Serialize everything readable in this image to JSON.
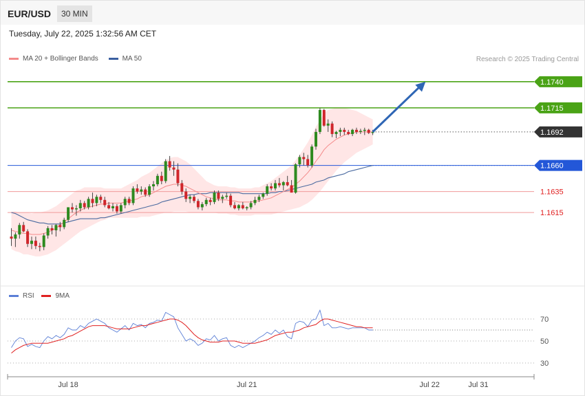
{
  "header": {
    "pair": "EUR/USD",
    "timeframe": "30 MIN"
  },
  "date_line": "Tuesday, July 22, 2025 1:32:56 AM CET",
  "legend": {
    "price": [
      {
        "label": "MA 20 + Bollinger Bands",
        "color": "#f48a8a"
      },
      {
        "label": "MA 50",
        "color": "#3a5fa0"
      }
    ],
    "rsi": [
      {
        "label": "RSI",
        "color": "#5b7fd6"
      },
      {
        "label": "9MA",
        "color": "#e02020"
      }
    ]
  },
  "credit": "Research © 2025 Trading Central",
  "chart_data": [
    {
      "type": "candlestick",
      "pair": "EUR/USD",
      "timeframe": "30 MIN",
      "ylim": [
        1.155,
        1.1755
      ],
      "levels": [
        {
          "value": 1.174,
          "label": "1.1740",
          "kind": "target",
          "color": "#4aa316"
        },
        {
          "value": 1.1715,
          "label": "1.1715",
          "kind": "resistance",
          "color": "#4aa316"
        },
        {
          "value": 1.1692,
          "label": "1.1692",
          "kind": "last",
          "color": "#333333"
        },
        {
          "value": 1.166,
          "label": "1.1660",
          "kind": "pivot",
          "color": "#2357d8"
        },
        {
          "value": 1.1635,
          "label": "1.1635",
          "kind": "support",
          "color": "#e04040"
        },
        {
          "value": 1.1615,
          "label": "1.1615",
          "kind": "support",
          "color": "#e04040"
        }
      ],
      "x_ticks": [
        {
          "label": "Jul 18",
          "index": 14
        },
        {
          "label": "Jul 21",
          "index": 58
        },
        {
          "label": "Jul 22",
          "index": 103
        },
        {
          "label": "Jul 31",
          "index": 115
        }
      ],
      "ohlc": [
        [
          1.1592,
          1.16,
          1.1583,
          1.159
        ],
        [
          1.159,
          1.1596,
          1.1582,
          1.1594
        ],
        [
          1.1594,
          1.1605,
          1.159,
          1.1603
        ],
        [
          1.1603,
          1.1606,
          1.1596,
          1.1597
        ],
        [
          1.1597,
          1.1599,
          1.1582,
          1.1585
        ],
        [
          1.1585,
          1.1592,
          1.158,
          1.1588
        ],
        [
          1.1588,
          1.1592,
          1.158,
          1.1583
        ],
        [
          1.1583,
          1.1586,
          1.1578,
          1.1582
        ],
        [
          1.1582,
          1.1595,
          1.1579,
          1.1593
        ],
        [
          1.1593,
          1.1602,
          1.159,
          1.16
        ],
        [
          1.16,
          1.1603,
          1.1594,
          1.1598
        ],
        [
          1.1598,
          1.1604,
          1.1592,
          1.1603
        ],
        [
          1.1603,
          1.1606,
          1.1597,
          1.1601
        ],
        [
          1.1601,
          1.161,
          1.1599,
          1.1608
        ],
        [
          1.1608,
          1.162,
          1.1606,
          1.162
        ],
        [
          1.162,
          1.1624,
          1.1615,
          1.1618
        ],
        [
          1.1618,
          1.1622,
          1.1612,
          1.1619
        ],
        [
          1.1619,
          1.1627,
          1.1616,
          1.1624
        ],
        [
          1.1624,
          1.1626,
          1.1618,
          1.162
        ],
        [
          1.162,
          1.163,
          1.1618,
          1.1628
        ],
        [
          1.1628,
          1.1634,
          1.162,
          1.1624
        ],
        [
          1.1624,
          1.1632,
          1.1621,
          1.163
        ],
        [
          1.163,
          1.1632,
          1.1624,
          1.1627
        ],
        [
          1.1627,
          1.163,
          1.162,
          1.1622
        ],
        [
          1.1622,
          1.1625,
          1.1618,
          1.1619
        ],
        [
          1.1619,
          1.1624,
          1.1616,
          1.1621
        ],
        [
          1.1621,
          1.1623,
          1.1614,
          1.1616
        ],
        [
          1.1616,
          1.1624,
          1.1614,
          1.1622
        ],
        [
          1.1622,
          1.163,
          1.1619,
          1.1628
        ],
        [
          1.1628,
          1.163,
          1.1622,
          1.1624
        ],
        [
          1.1624,
          1.164,
          1.1622,
          1.1638
        ],
        [
          1.1638,
          1.1642,
          1.1633,
          1.1635
        ],
        [
          1.1635,
          1.164,
          1.1632,
          1.1637
        ],
        [
          1.1637,
          1.1639,
          1.163,
          1.1632
        ],
        [
          1.1632,
          1.1642,
          1.163,
          1.164
        ],
        [
          1.164,
          1.1645,
          1.1636,
          1.1642
        ],
        [
          1.1642,
          1.1652,
          1.164,
          1.165
        ],
        [
          1.165,
          1.1654,
          1.1642,
          1.1645
        ],
        [
          1.1645,
          1.1666,
          1.1643,
          1.1664
        ],
        [
          1.1664,
          1.1669,
          1.1655,
          1.1658
        ],
        [
          1.1658,
          1.1664,
          1.165,
          1.1656
        ],
        [
          1.1656,
          1.1662,
          1.164,
          1.1643
        ],
        [
          1.1643,
          1.1646,
          1.1632,
          1.1635
        ],
        [
          1.1635,
          1.1638,
          1.1625,
          1.1628
        ],
        [
          1.1628,
          1.1632,
          1.1624,
          1.163
        ],
        [
          1.163,
          1.1632,
          1.1624,
          1.1626
        ],
        [
          1.1626,
          1.1628,
          1.1618,
          1.162
        ],
        [
          1.162,
          1.1625,
          1.1617,
          1.1623
        ],
        [
          1.1623,
          1.1629,
          1.1621,
          1.1627
        ],
        [
          1.1627,
          1.1629,
          1.1622,
          1.1625
        ],
        [
          1.1625,
          1.1636,
          1.1623,
          1.1634
        ],
        [
          1.1634,
          1.1636,
          1.1626,
          1.1628
        ],
        [
          1.1628,
          1.1632,
          1.1624,
          1.163
        ],
        [
          1.163,
          1.1634,
          1.1628,
          1.1631
        ],
        [
          1.1631,
          1.1633,
          1.162,
          1.1622
        ],
        [
          1.1622,
          1.1625,
          1.1618,
          1.1619
        ],
        [
          1.1619,
          1.1623,
          1.1617,
          1.1622
        ],
        [
          1.1622,
          1.1625,
          1.1618,
          1.1619
        ],
        [
          1.1619,
          1.1621,
          1.1617,
          1.162
        ],
        [
          1.162,
          1.1626,
          1.1618,
          1.1624
        ],
        [
          1.1624,
          1.163,
          1.1622,
          1.1627
        ],
        [
          1.1627,
          1.1632,
          1.1625,
          1.163
        ],
        [
          1.163,
          1.1634,
          1.1628,
          1.1633
        ],
        [
          1.1633,
          1.1642,
          1.1631,
          1.164
        ],
        [
          1.164,
          1.1643,
          1.1636,
          1.1638
        ],
        [
          1.1638,
          1.1646,
          1.1636,
          1.1643
        ],
        [
          1.1643,
          1.1648,
          1.1639,
          1.1641
        ],
        [
          1.1641,
          1.1645,
          1.1636,
          1.1644
        ],
        [
          1.1644,
          1.165,
          1.164,
          1.1641
        ],
        [
          1.1641,
          1.1646,
          1.1635,
          1.1634
        ],
        [
          1.1634,
          1.1662,
          1.1633,
          1.1661
        ],
        [
          1.1661,
          1.167,
          1.1658,
          1.1668
        ],
        [
          1.1668,
          1.1672,
          1.166,
          1.1666
        ],
        [
          1.1666,
          1.167,
          1.1658,
          1.166
        ],
        [
          1.166,
          1.168,
          1.1658,
          1.1678
        ],
        [
          1.1678,
          1.1695,
          1.1675,
          1.1692
        ],
        [
          1.1692,
          1.1715,
          1.169,
          1.1713
        ],
        [
          1.1713,
          1.1714,
          1.1697,
          1.1698
        ],
        [
          1.1698,
          1.1704,
          1.1692,
          1.17
        ],
        [
          1.17,
          1.1702,
          1.1687,
          1.169
        ],
        [
          1.169,
          1.1693,
          1.1686,
          1.1692
        ],
        [
          1.1692,
          1.1696,
          1.1688,
          1.1694
        ],
        [
          1.1694,
          1.1696,
          1.1689,
          1.1692
        ],
        [
          1.1692,
          1.1694,
          1.1689,
          1.169
        ],
        [
          1.169,
          1.1695,
          1.1688,
          1.1694
        ],
        [
          1.1694,
          1.1696,
          1.169,
          1.1692
        ],
        [
          1.1692,
          1.1695,
          1.169,
          1.1693
        ],
        [
          1.1693,
          1.1696,
          1.1689,
          1.1694
        ],
        [
          1.1694,
          1.1695,
          1.169,
          1.1691
        ],
        [
          1.1691,
          1.1694,
          1.1689,
          1.1692
        ]
      ],
      "ma20": [
        1.1598,
        1.1597,
        1.1596,
        1.1595,
        1.1595,
        1.1594,
        1.1594,
        1.1594,
        1.1595,
        1.1596,
        1.1598,
        1.16,
        1.1603,
        1.1606,
        1.1609,
        1.1612,
        1.1615,
        1.1617,
        1.1619,
        1.162,
        1.1621,
        1.1622,
        1.1623,
        1.1623,
        1.1624,
        1.1624,
        1.1624,
        1.1624,
        1.1625,
        1.1626,
        1.1627,
        1.1628,
        1.163,
        1.1631,
        1.1632,
        1.1634,
        1.1636,
        1.1638,
        1.164,
        1.1641,
        1.1642,
        1.1642,
        1.1641,
        1.164,
        1.1638,
        1.1636,
        1.1634,
        1.1632,
        1.163,
        1.1629,
        1.1628,
        1.1627,
        1.1627,
        1.1627,
        1.1626,
        1.1626,
        1.1625,
        1.1625,
        1.1625,
        1.1625,
        1.1626,
        1.1626,
        1.1627,
        1.1628,
        1.1629,
        1.1631,
        1.1633,
        1.1635,
        1.1637,
        1.1639,
        1.1642,
        1.1645,
        1.1649,
        1.1653,
        1.1658,
        1.1664,
        1.1669,
        1.1675,
        1.1679,
        1.1682,
        1.1685,
        1.1687,
        1.1689,
        1.169,
        1.1691,
        1.1692,
        1.1692,
        1.1692,
        1.1692,
        1.1692
      ],
      "ma50": [
        1.1615,
        1.1614,
        1.1612,
        1.161,
        1.1608,
        1.1607,
        1.1606,
        1.1605,
        1.1605,
        1.1604,
        1.1604,
        1.1604,
        1.1604,
        1.1605,
        1.1606,
        1.1607,
        1.1608,
        1.1609,
        1.1609,
        1.1609,
        1.1609,
        1.1609,
        1.161,
        1.161,
        1.1611,
        1.1612,
        1.1613,
        1.1614,
        1.1615,
        1.1616,
        1.1617,
        1.1618,
        1.1619,
        1.162,
        1.1621,
        1.1622,
        1.1623,
        1.1625,
        1.1626,
        1.1627,
        1.1628,
        1.1629,
        1.163,
        1.1631,
        1.1632,
        1.1632,
        1.1633,
        1.1633,
        1.1633,
        1.1634,
        1.1634,
        1.1634,
        1.1634,
        1.1634,
        1.1634,
        1.1634,
        1.1634,
        1.1633,
        1.1633,
        1.1633,
        1.1633,
        1.1633,
        1.1633,
        1.1633,
        1.1634,
        1.1634,
        1.1635,
        1.1635,
        1.1636,
        1.1637,
        1.1638,
        1.1639,
        1.164,
        1.1641,
        1.1642,
        1.1644,
        1.1645,
        1.1646,
        1.1648,
        1.1649,
        1.165,
        1.1651,
        1.1652,
        1.1654,
        1.1655,
        1.1656,
        1.1657,
        1.1658,
        1.1659,
        1.166
      ],
      "bb_width": [
        0.0018,
        0.0019,
        0.0019,
        0.002,
        0.002,
        0.002,
        0.0021,
        0.0021,
        0.0021,
        0.0021,
        0.0021,
        0.0021,
        0.0021,
        0.0021,
        0.0021,
        0.0021,
        0.0021,
        0.002,
        0.002,
        0.0019,
        0.0018,
        0.0017,
        0.0016,
        0.0015,
        0.0014,
        0.0014,
        0.0014,
        0.0014,
        0.0015,
        0.0016,
        0.0017,
        0.0018,
        0.0019,
        0.002,
        0.0021,
        0.0022,
        0.0023,
        0.0024,
        0.0025,
        0.0026,
        0.0026,
        0.0026,
        0.0025,
        0.0024,
        0.0023,
        0.0021,
        0.0019,
        0.0017,
        0.0015,
        0.0014,
        0.0013,
        0.0013,
        0.0013,
        0.0013,
        0.0013,
        0.0013,
        0.0013,
        0.0013,
        0.0013,
        0.0013,
        0.0013,
        0.0013,
        0.0014,
        0.0015,
        0.0016,
        0.0017,
        0.0018,
        0.0019,
        0.002,
        0.0021,
        0.0023,
        0.0025,
        0.0027,
        0.0029,
        0.0031,
        0.0033,
        0.0034,
        0.0035,
        0.0034,
        0.0032,
        0.003,
        0.0028,
        0.0026,
        0.0024,
        0.0022,
        0.002,
        0.0018,
        0.0016,
        0.0014,
        0.0012
      ],
      "projection": {
        "from_index": 89,
        "from": 1.1692,
        "to_index": 102,
        "to": 1.174
      }
    },
    {
      "type": "line",
      "name": "RSI panel",
      "ylim": [
        20,
        80
      ],
      "y_ticks": [
        70,
        50,
        30
      ],
      "series": [
        {
          "name": "RSI",
          "color": "#5b7fd6",
          "values": [
            44,
            50,
            53,
            52,
            45,
            47,
            45,
            44,
            50,
            54,
            52,
            55,
            53,
            56,
            62,
            60,
            60,
            64,
            62,
            66,
            68,
            70,
            68,
            66,
            62,
            60,
            58,
            61,
            64,
            60,
            66,
            64,
            65,
            62,
            66,
            67,
            69,
            68,
            76,
            74,
            72,
            62,
            56,
            50,
            52,
            50,
            46,
            48,
            52,
            51,
            55,
            50,
            52,
            53,
            46,
            44,
            46,
            44,
            46,
            48,
            50,
            53,
            55,
            58,
            56,
            60,
            57,
            60,
            54,
            52,
            66,
            68,
            67,
            63,
            69,
            70,
            78,
            64,
            66,
            62,
            62,
            63,
            62,
            61,
            62,
            62,
            62,
            62,
            60,
            60
          ]
        },
        {
          "name": "9MA",
          "color": "#e02020",
          "values": [
            39,
            42,
            44,
            46,
            47,
            48,
            48,
            48,
            48,
            48,
            49,
            50,
            51,
            52,
            54,
            55,
            57,
            59,
            61,
            63,
            64,
            64,
            64,
            64,
            63,
            62,
            61,
            61,
            61,
            61,
            62,
            63,
            64,
            64,
            65,
            66,
            67,
            68,
            69,
            70,
            70,
            69,
            67,
            64,
            60,
            56,
            53,
            51,
            50,
            49,
            49,
            49,
            50,
            50,
            50,
            50,
            49,
            48,
            48,
            48,
            48,
            49,
            50,
            51,
            53,
            55,
            56,
            57,
            58,
            58,
            59,
            60,
            62,
            63,
            64,
            65,
            68,
            70,
            70,
            69,
            68,
            67,
            66,
            65,
            64,
            63,
            63,
            62,
            62,
            62
          ]
        }
      ]
    }
  ]
}
